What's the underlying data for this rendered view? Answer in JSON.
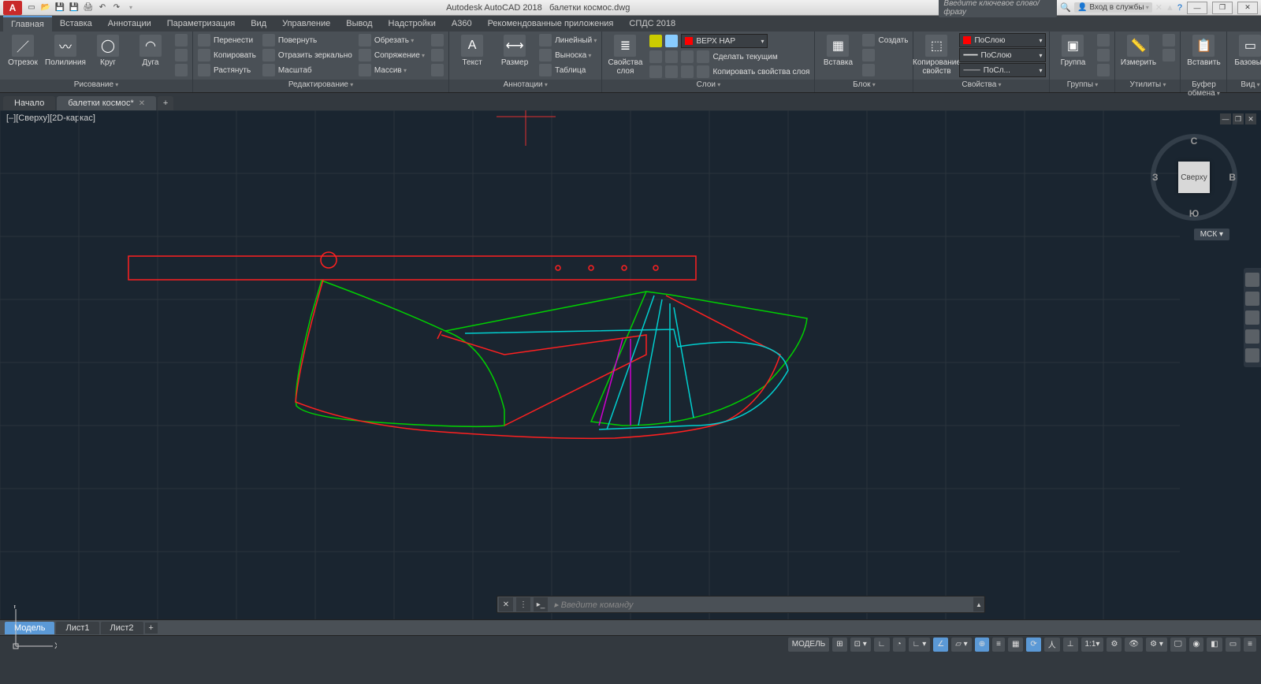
{
  "title": {
    "app": "Autodesk AutoCAD 2018",
    "file": "балетки космос.dwg"
  },
  "search_placeholder": "Введите ключевое слово/фразу",
  "signin": "Вход в службы",
  "menus": [
    "Главная",
    "Вставка",
    "Аннотации",
    "Параметризация",
    "Вид",
    "Управление",
    "Вывод",
    "Надстройки",
    "A360",
    "Рекомендованные приложения",
    "СПДС 2018"
  ],
  "active_menu": 0,
  "ribbon": {
    "draw": {
      "title": "Рисование",
      "line": "Отрезок",
      "polyline": "Полилиния",
      "circle": "Круг",
      "arc": "Дуга"
    },
    "modify": {
      "title": "Редактирование",
      "move": "Перенести",
      "rotate": "Повернуть",
      "trim": "Обрезать",
      "copy": "Копировать",
      "mirror": "Отразить зеркально",
      "fillet": "Сопряжение",
      "stretch": "Растянуть",
      "scale": "Масштаб",
      "array": "Массив"
    },
    "annot": {
      "title": "Аннотации",
      "text": "Текст",
      "dim": "Размер",
      "linear": "Линейный",
      "leader": "Выноска",
      "table": "Таблица"
    },
    "layers": {
      "title": "Слои",
      "props": "Свойства слоя",
      "current": "ВЕРХ НАР",
      "make": "Сделать текущим",
      "copyp": "Копировать свойства слоя"
    },
    "block": {
      "title": "Блок",
      "insert": "Вставка",
      "create": "Создать"
    },
    "props": {
      "title": "Свойства",
      "byLayer": "ПоСлою",
      "lt1": "ПоСлою",
      "lt2": "ПоСл...",
      "panel": "Копирование свойств"
    },
    "groups": {
      "title": "Группы",
      "group": "Группа"
    },
    "util": {
      "title": "Утилиты",
      "measure": "Измерить"
    },
    "clip": {
      "title": "Буфер обмена",
      "paste": "Вставить"
    },
    "view": {
      "title": "Вид",
      "base": "Базовый"
    }
  },
  "filetabs": {
    "start": "Начало",
    "doc": "балетки космос*"
  },
  "viewport_label": "[–][Сверху][2D-каркас]",
  "viewcube": {
    "face": "Сверху",
    "n": "С",
    "s": "Ю",
    "w": "З",
    "e": "В",
    "wcs": "МСК"
  },
  "ucs": {
    "x": "X",
    "y": "Y"
  },
  "cmd": {
    "prompt": "Введите команду"
  },
  "layouts": {
    "model": "Модель",
    "sheet1": "Лист1",
    "sheet2": "Лист2"
  },
  "status": {
    "model": "МОДЕЛЬ",
    "scale": "1:1"
  }
}
